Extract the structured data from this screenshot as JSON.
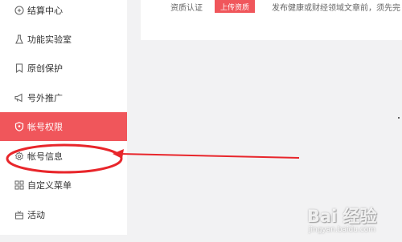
{
  "sidebar": {
    "items": [
      {
        "label": "结算中心",
        "icon": "settlement-icon"
      },
      {
        "label": "功能实验室",
        "icon": "flask-icon"
      },
      {
        "label": "原创保护",
        "icon": "bookmark-icon"
      },
      {
        "label": "号外推广",
        "icon": "megaphone-icon"
      },
      {
        "label": "帐号权限",
        "icon": "shield-icon",
        "active": true
      },
      {
        "label": "帐号信息",
        "icon": "gear-icon"
      },
      {
        "label": "自定义菜单",
        "icon": "grid-icon"
      },
      {
        "label": "活动",
        "icon": "gift-icon"
      }
    ]
  },
  "main": {
    "qualification_label": "资质认证",
    "upload_button": "上传资质",
    "notice": "发布健康或财经领域文章前，须先完"
  },
  "watermark": {
    "brand": "Bai 经验",
    "url": "jingyan.baidu.com"
  },
  "colors": {
    "accent": "#f0565b",
    "annotation": "#e8262b",
    "page_bg": "#f2f2f3"
  }
}
